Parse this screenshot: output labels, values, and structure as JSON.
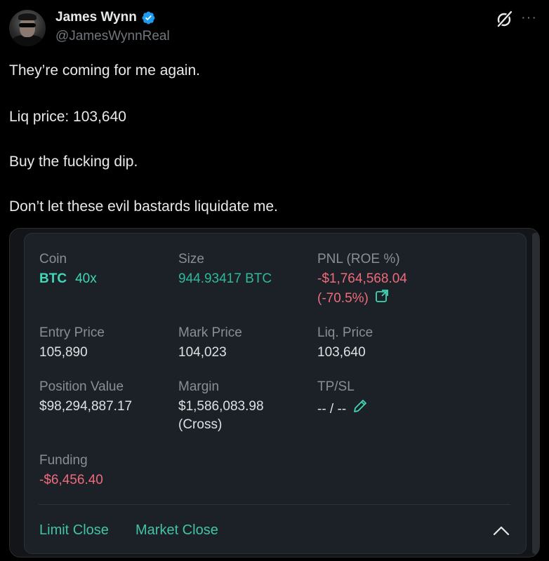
{
  "author": {
    "display_name": "James Wynn",
    "handle": "@JamesWynnReal",
    "verified_icon": "verified-badge-icon",
    "avatar_icon": "profile-avatar"
  },
  "header_icons": {
    "grok": "grok-icon",
    "more": "more-options-icon"
  },
  "tweet": {
    "lines": [
      "They’re coming for me again.",
      "Liq price: 103,640",
      "Buy the fucking dip.",
      "Don’t let these evil bastards liquidate me."
    ]
  },
  "position": {
    "coin_label": "Coin",
    "coin": "BTC",
    "leverage": "40x",
    "size_label": "Size",
    "size": "944.93417 BTC",
    "pnl_label": "PNL (ROE %)",
    "pnl": "-$1,764,568.04",
    "roe": "(-70.5%)",
    "entry_label": "Entry Price",
    "entry": "105,890",
    "mark_label": "Mark Price",
    "mark": "104,023",
    "liq_label": "Liq. Price",
    "liq": "103,640",
    "value_label": "Position Value",
    "value": "$98,294,887.17",
    "margin_label": "Margin",
    "margin": "$1,586,083.98",
    "margin_mode": "(Cross)",
    "tpsl_label": "TP/SL",
    "tpsl": "-- / --",
    "funding_label": "Funding",
    "funding": "-$6,456.40",
    "limit_close": "Limit Close",
    "market_close": "Market Close"
  },
  "colors": {
    "background": "#000000",
    "accent_green": "#3fd7b8",
    "negative_red": "#ee6b7c",
    "verified_blue": "#1d9bf0"
  }
}
